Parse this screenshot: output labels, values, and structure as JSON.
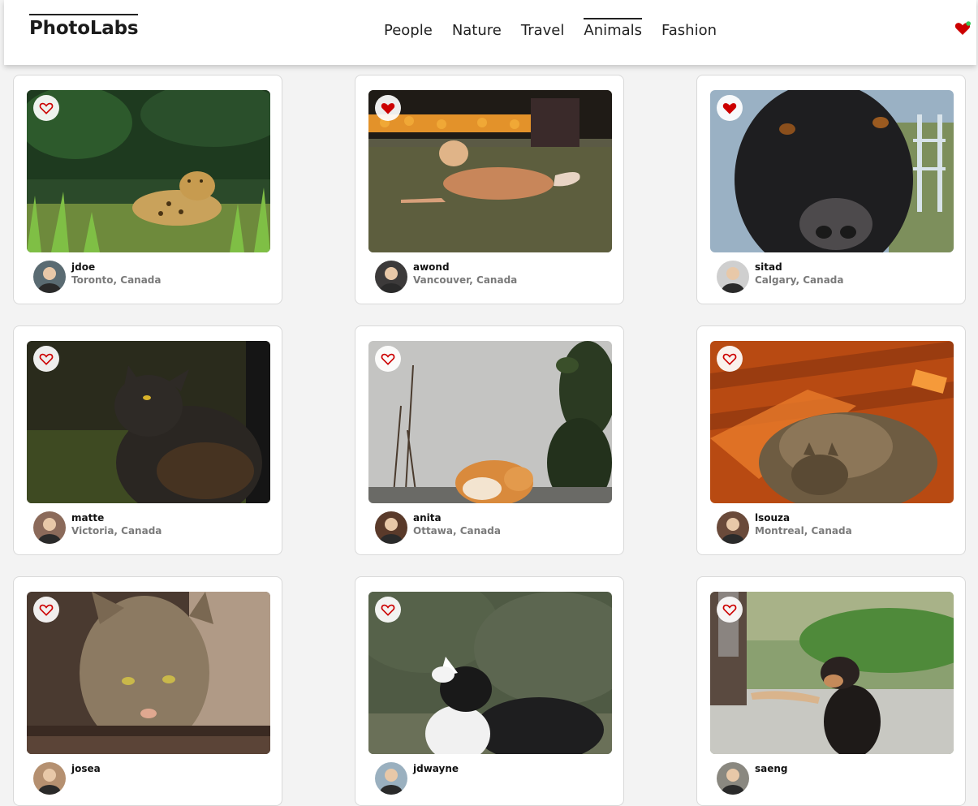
{
  "app": {
    "title": "PhotoLabs"
  },
  "nav": {
    "topics": [
      "People",
      "Nature",
      "Travel",
      "Animals",
      "Fashion"
    ],
    "active_topic": "Animals",
    "fav_badge": {
      "heart_color": "#cc0000",
      "dot_color": "#34c759"
    }
  },
  "colors": {
    "heart": "#cc0000",
    "location": "#7a7a7a"
  },
  "photos": [
    {
      "username": "jdoe",
      "location": "Toronto, Canada",
      "favorited": false,
      "subject": "jaguar-in-grass"
    },
    {
      "username": "awond",
      "location": "Vancouver, Canada",
      "favorited": true,
      "subject": "dog-on-lawn"
    },
    {
      "username": "sitad",
      "location": "Calgary, Canada",
      "favorited": true,
      "subject": "black-dog-closeup"
    },
    {
      "username": "matte",
      "location": "Victoria, Canada",
      "favorited": false,
      "subject": "black-cat"
    },
    {
      "username": "anita",
      "location": "Ottawa, Canada",
      "favorited": false,
      "subject": "orange-cat-by-wall"
    },
    {
      "username": "lsouza",
      "location": "Montreal, Canada",
      "favorited": false,
      "subject": "tabby-cat-in-sun"
    },
    {
      "username": "josea",
      "location": "",
      "favorited": false,
      "subject": "tabby-cat-drinking"
    },
    {
      "username": "jdwayne",
      "location": "",
      "favorited": false,
      "subject": "border-collie"
    },
    {
      "username": "saeng",
      "location": "",
      "favorited": false,
      "subject": "dog-giving-paw"
    }
  ]
}
